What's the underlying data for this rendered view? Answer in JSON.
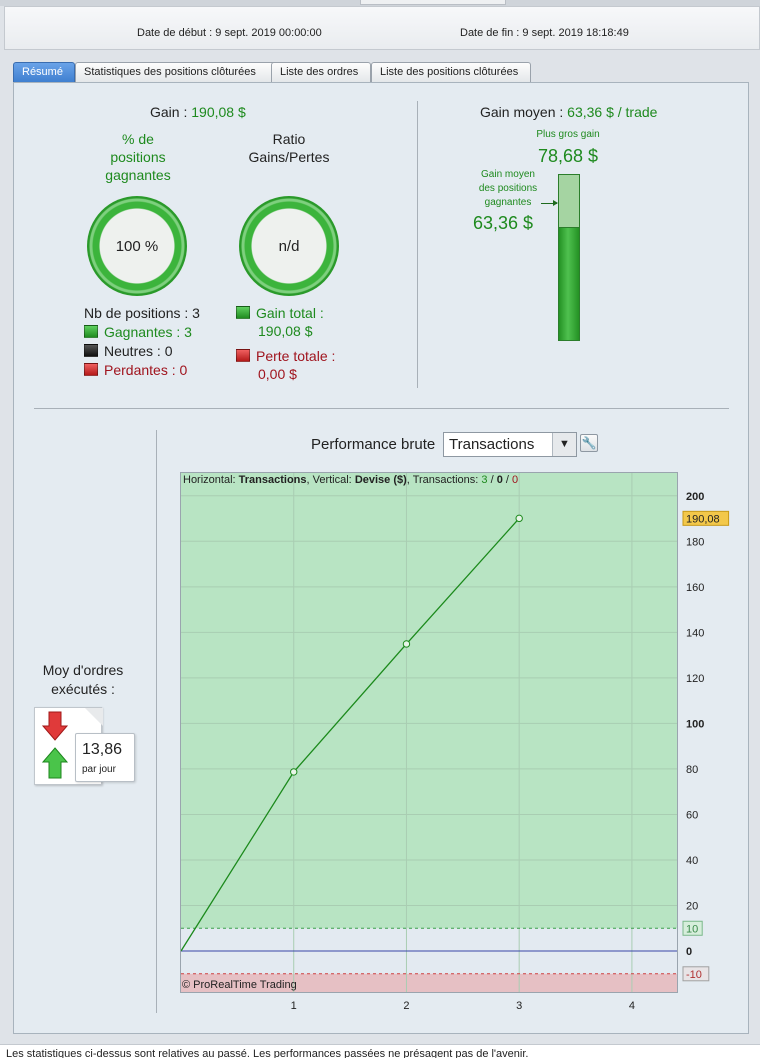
{
  "header": {
    "start_label": "Date de début :",
    "start_value": "9 sept. 2019 00:00:00",
    "end_label": "Date de fin :",
    "end_value": "9 sept. 2019 18:18:49"
  },
  "tabs": [
    {
      "label": "Résumé",
      "active": true
    },
    {
      "label": "Statistiques des positions clôturées",
      "active": false
    },
    {
      "label": "Liste des ordres",
      "active": false
    },
    {
      "label": "Liste des positions clôturées",
      "active": false
    }
  ],
  "summary": {
    "gain_label": "Gain :",
    "gain_value": "190,08 $",
    "pct_title_lines": [
      "% de",
      "positions",
      "gagnantes"
    ],
    "pct_value": "100 %",
    "pct_fraction": 1.0,
    "ratio_title_lines": [
      "Ratio",
      "Gains/Pertes"
    ],
    "ratio_value": "n/d",
    "nb_positions": "Nb de positions : 3",
    "winners": "Gagnantes : 3",
    "neutral": "Neutres : 0",
    "losers": "Perdantes : 0",
    "total_gain_label": "Gain total :",
    "total_gain_value": "190,08 $",
    "total_loss_label": "Perte totale :",
    "total_loss_value": "0,00 $"
  },
  "average": {
    "title_label": "Gain moyen :",
    "title_value": "63,36 $ / trade",
    "biggest_label": "Plus gros gain",
    "biggest_value": "78,68 $",
    "avg_win_lines": [
      "Gain moyen",
      "des positions",
      "gagnantes"
    ],
    "avg_win_value": "63,36 $",
    "biggest_amount": 78.68,
    "avg_amount": 63.36
  },
  "orders": {
    "title_lines": [
      "Moy d'ordres",
      "exécutés :"
    ],
    "value": "13,86",
    "unit": "par jour"
  },
  "performance": {
    "title": "Performance brute",
    "mode": "Transactions",
    "info_prefix": "Horizontal:",
    "info_h": "Transactions",
    "info_mid": ", Vertical:",
    "info_v": "Devise ($)",
    "info_tx": ", Transactions:",
    "info_win": "3",
    "info_sep": "/",
    "info_neutral": "0",
    "info_loss": "0",
    "copyright": "© ProRealTime Trading",
    "current_label": "190,08",
    "upper_label": "10",
    "lower_label": "-10"
  },
  "chart_data": {
    "type": "line",
    "x": [
      0,
      1,
      2,
      3
    ],
    "y": [
      0,
      78.68,
      134.9,
      190.08
    ],
    "xlim": [
      0,
      4.4
    ],
    "ylim": [
      -18,
      210
    ],
    "xticks": [
      1,
      2,
      3,
      4
    ],
    "yticks": [
      0,
      20,
      40,
      60,
      80,
      100,
      120,
      140,
      160,
      180,
      200
    ],
    "bold_yticks": [
      0,
      100,
      200
    ],
    "upper_threshold": 10,
    "lower_threshold": -10,
    "colors": {
      "line": "#1c8a1c",
      "gain_zone": "#b8e4c3",
      "loss_zone": "#e6c0c4",
      "zero_line": "#3845a8"
    }
  },
  "footer": "Les statistiques ci-dessus sont relatives au passé. Les performances passées ne présagent pas de l'avenir."
}
